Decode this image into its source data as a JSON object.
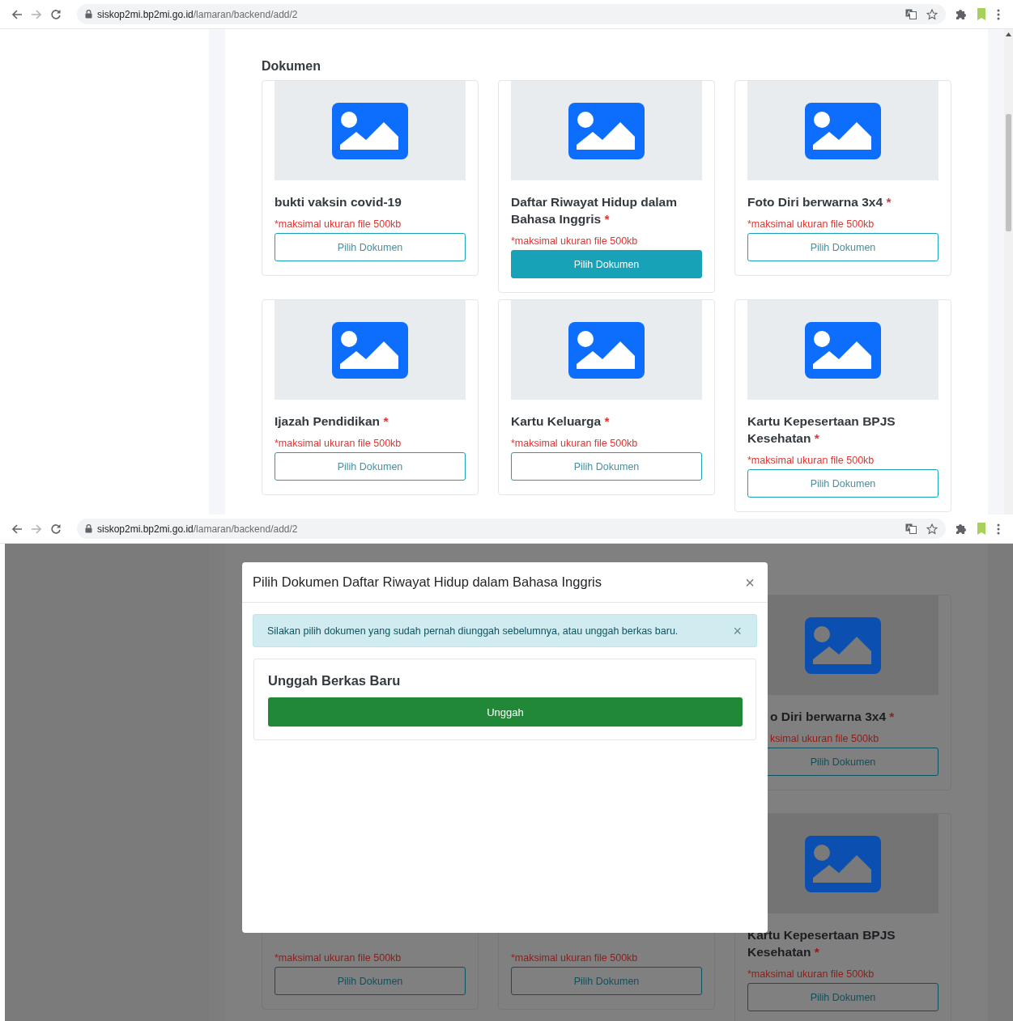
{
  "screens": [
    {
      "kind": "page",
      "address": {
        "host": "siskop2mi.bp2mi.go.id",
        "path": "/lamaran/backend/add/2"
      },
      "section_title": "Dokumen",
      "documents": [
        {
          "title": "bukti vaksin covid-19",
          "note": "*maksimal ukuran file 500kb",
          "button": "Pilih Dokumen",
          "hovered": false
        },
        {
          "title": "Daftar Riwayat Hidup dalam Bahasa Inggris",
          "required_mark": "*",
          "note": "*maksimal ukuran file 500kb",
          "button": "Pilih Dokumen",
          "hovered": true
        },
        {
          "title": "Foto Diri berwarna 3x4",
          "required_mark": "*",
          "note": "*maksimal ukuran file 500kb",
          "button": "Pilih Dokumen",
          "hovered": false
        },
        {
          "title": "Ijazah Pendidikan",
          "required_mark": "*",
          "note": "*maksimal ukuran file 500kb",
          "button": "Pilih Dokumen",
          "hovered": false
        },
        {
          "title": "Kartu Keluarga",
          "required_mark": "*",
          "note": "*maksimal ukuran file 500kb",
          "button": "Pilih Dokumen",
          "hovered": false
        },
        {
          "title": "Kartu Kepesertaan BPJS Kesehatan",
          "required_mark": "*",
          "note": "*maksimal ukuran file 500kb",
          "button": "Pilih Dokumen",
          "hovered": false
        }
      ]
    },
    {
      "kind": "modal_open",
      "address": {
        "host": "siskop2mi.bp2mi.go.id",
        "path": "/lamaran/backend/add/2"
      },
      "background_columns": [
        {
          "cards": [
            {
              "kind": "lower_part",
              "note": "*maksimal ukuran file 500kb",
              "button": "Pilih Dokumen"
            }
          ]
        },
        {
          "cards": [
            {
              "kind": "lower_part",
              "note": "*maksimal ukuran file 500kb",
              "button": "Pilih Dokumen"
            }
          ]
        },
        {
          "cards": [
            {
              "kind": "right_edge",
              "title": "o Diri berwarna 3x4",
              "required_mark": "*",
              "note": "ksimal ukuran file 500kb",
              "button": "Pilih Dokumen"
            },
            {
              "kind": "whole",
              "title": "Kartu Kepesertaan BPJS Kesehatan",
              "required_mark": "*",
              "note": "*maksimal ukuran file 500kb",
              "button": "Pilih Dokumen"
            }
          ]
        }
      ],
      "modal": {
        "title": "Pilih Dokumen Daftar Riwayat Hidup dalam Bahasa Inggris",
        "close": "×",
        "alert": {
          "text": "Silakan pilih dokumen yang sudah pernah diunggah sebelumnya, atau unggah berkas baru.",
          "close": "×"
        },
        "upload_card": {
          "heading": "Unggah Berkas Baru",
          "button": "Unggah"
        }
      }
    }
  ]
}
